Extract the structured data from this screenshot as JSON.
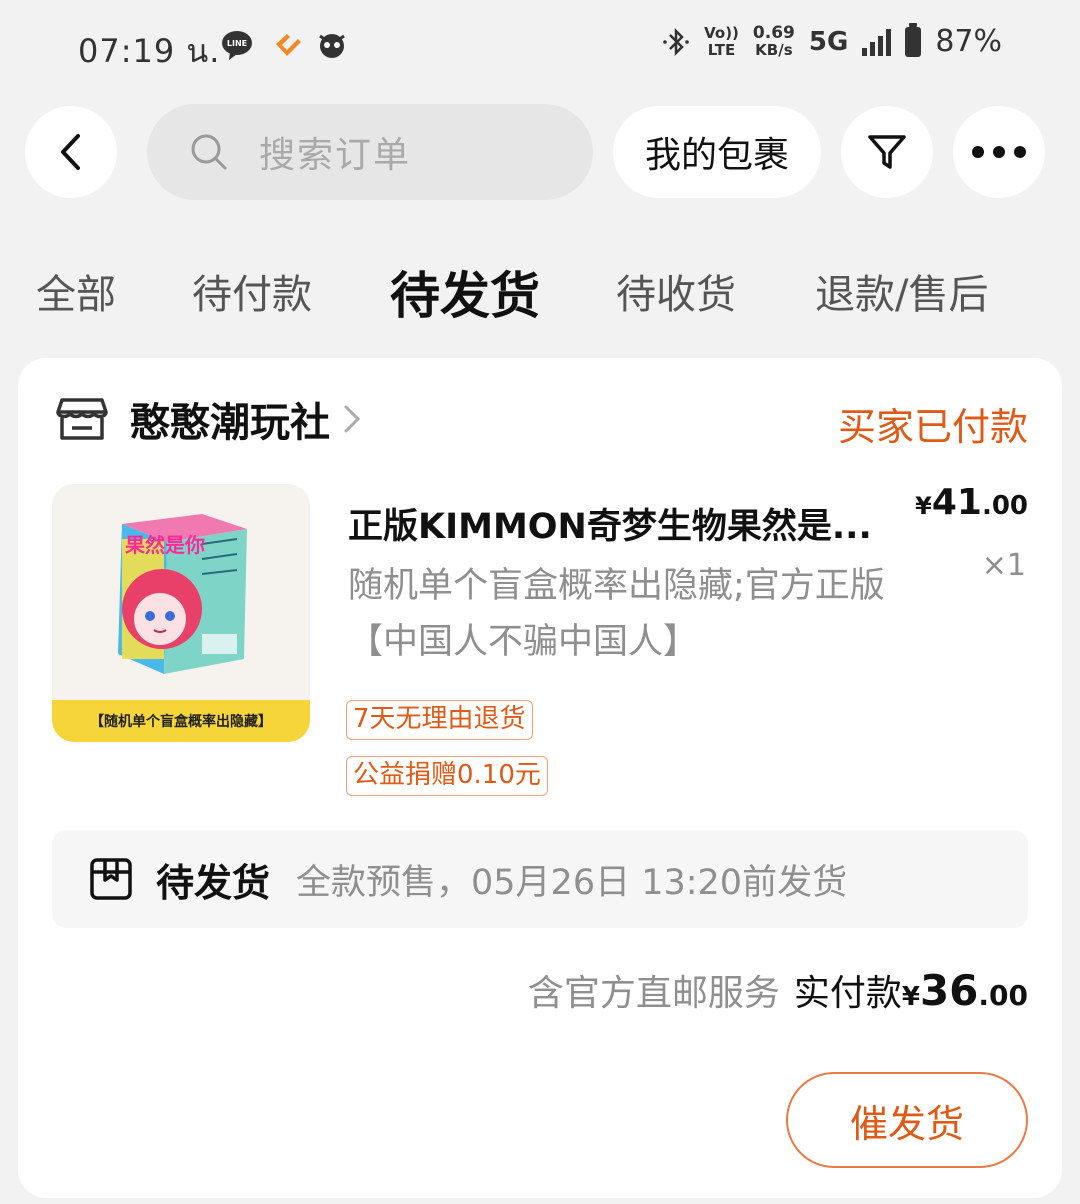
{
  "status_bar": {
    "time": "07:19 น.",
    "app_icons": [
      "line-icon",
      "heart-chat-icon",
      "mascot-icon"
    ],
    "volte_top": "Vo))",
    "volte_bottom": "LTE",
    "speed_value": "0.69",
    "speed_unit": "KB/s",
    "network": "5G",
    "battery": "87%"
  },
  "top_bar": {
    "back_icon": "chevron-left-icon",
    "search_placeholder": "搜索订单",
    "packages_label": "我的包裹",
    "filter_icon": "filter-icon",
    "more_icon": "more-dots-icon"
  },
  "tabs": [
    {
      "label": "全部",
      "active": false
    },
    {
      "label": "待付款",
      "active": false
    },
    {
      "label": "待发货",
      "active": true
    },
    {
      "label": "待收货",
      "active": false
    },
    {
      "label": "退款/售后",
      "active": false
    }
  ],
  "order": {
    "shop_name": "憨憨潮玩社",
    "status": "买家已付款",
    "product": {
      "title": "正版KIMMON奇梦生物果然是...",
      "spec": "随机单个盲盒概率出隐藏;官方正版【中国人不骗中国人】",
      "image_caption": "【随机单个盲盒概率出隐藏】",
      "box_text": "果然是你",
      "price_symbol": "¥",
      "price_int": "41",
      "price_dec": ".00",
      "quantity": "×1",
      "tags": [
        "7天无理由退货",
        "公益捐赠0.10元"
      ]
    },
    "shipping": {
      "label": "待发货",
      "note": "全款预售，05月26日 13:20前发货"
    },
    "total": {
      "service": "含官方直邮服务",
      "label": "实付款",
      "symbol": "¥",
      "int": "36",
      "dec": ".00"
    },
    "urge_button": "催发货"
  },
  "colors": {
    "accent": "#e05a17",
    "background": "#f2f2f2",
    "card": "#ffffff"
  }
}
